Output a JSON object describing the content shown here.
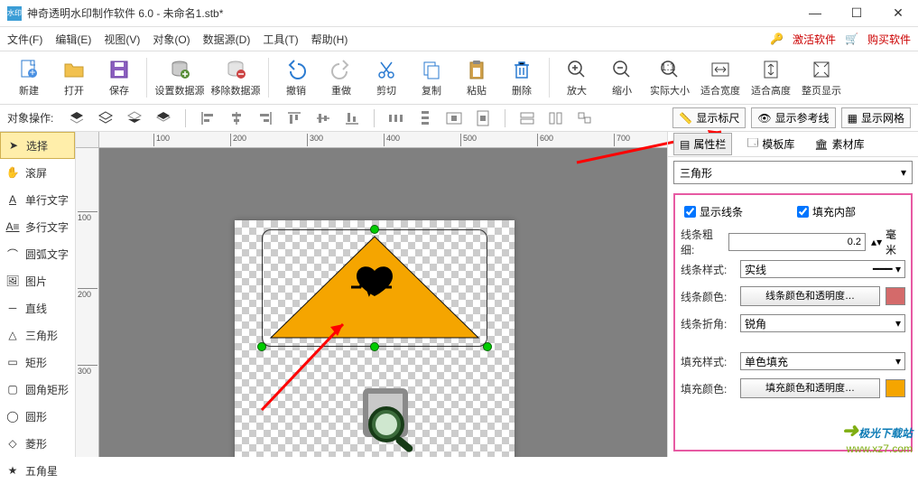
{
  "title": "神奇透明水印制作软件 6.0 - 未命名1.stb*",
  "menu": [
    "文件(F)",
    "编辑(E)",
    "视图(V)",
    "对象(O)",
    "数据源(D)",
    "工具(T)",
    "帮助(H)"
  ],
  "menu_right": {
    "activate": "激活软件",
    "buy": "购买软件"
  },
  "toolbar": {
    "new": "新建",
    "open": "打开",
    "save": "保存",
    "dataset": "设置数据源",
    "dsremove": "移除数据源",
    "undo": "撤销",
    "redo": "重做",
    "cut": "剪切",
    "copy": "复制",
    "paste": "粘贴",
    "delete": "删除",
    "zoomin": "放大",
    "zoomout": "缩小",
    "actual": "实际大小",
    "fitw": "适合宽度",
    "fith": "适合高度",
    "fitpage": "整页显示"
  },
  "ops_label": "对象操作:",
  "view_toggles": {
    "ruler": "显示标尺",
    "guide": "显示参考线",
    "grid": "显示网格"
  },
  "tools": [
    "选择",
    "滚屏",
    "单行文字",
    "多行文字",
    "圆弧文字",
    "图片",
    "直线",
    "三角形",
    "矩形",
    "圆角矩形",
    "圆形",
    "菱形",
    "五角星"
  ],
  "selected_tool_index": 0,
  "ruler_h": [
    "100",
    "200",
    "300",
    "400",
    "500",
    "600",
    "700"
  ],
  "ruler_v": [
    "100",
    "200",
    "300"
  ],
  "right": {
    "tabs": {
      "props": "属性栏",
      "templates": "模板库",
      "assets": "素材库"
    },
    "shape_name": "三角形",
    "show_line": "显示线条",
    "fill_inside": "填充内部",
    "line_width_lbl": "线条粗细:",
    "line_width_val": "0.2",
    "line_width_unit": "毫米",
    "line_style_lbl": "线条样式:",
    "line_style_val": "实线",
    "line_color_lbl": "线条颜色:",
    "line_color_btn": "线条颜色和透明度…",
    "line_color": "#d46a6a",
    "line_corner_lbl": "线条折角:",
    "line_corner_val": "锐角",
    "fill_style_lbl": "填充样式:",
    "fill_style_val": "单色填充",
    "fill_color_lbl": "填充颜色:",
    "fill_color_btn": "填充颜色和透明度…",
    "fill_color": "#f5a500"
  },
  "watermark": {
    "t1": "极光下载站",
    "t2": "www.xz7.com"
  }
}
